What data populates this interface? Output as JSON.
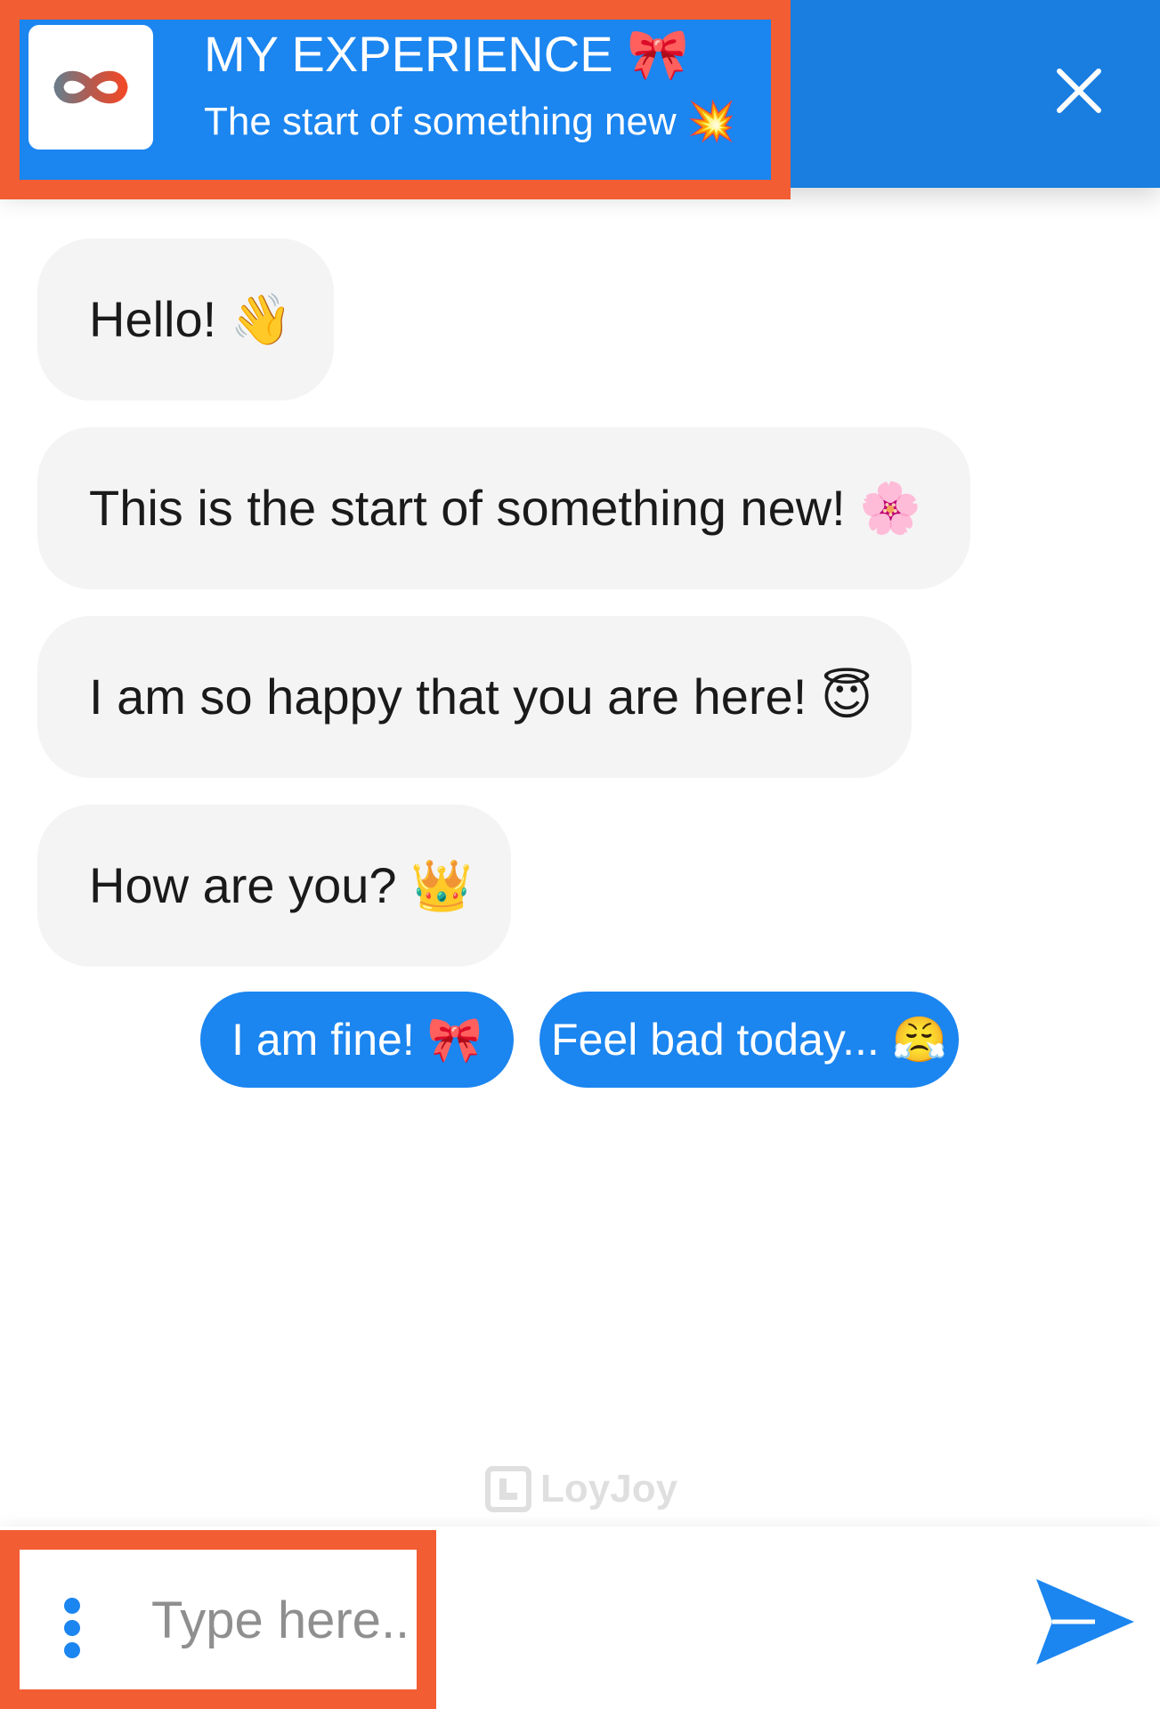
{
  "header": {
    "title": "MY EXPERIENCE 🎀",
    "subtitle": "The start of something new 💥",
    "logo_icon": "infinity-logo-icon",
    "close_icon": "close-icon",
    "background_color": "#1b85f0",
    "highlight_color": "#f25d34"
  },
  "messages": [
    {
      "text": "Hello! 👋"
    },
    {
      "text": "This is the start of something new! 🌸"
    },
    {
      "text": "I am so happy that you are here! 😇"
    },
    {
      "text": "How are you? 👑"
    }
  ],
  "quick_replies": [
    {
      "label": "I am fine! 🎀"
    },
    {
      "label": "Feel bad today... 😤"
    }
  ],
  "watermark": {
    "text": "LoyJoy"
  },
  "composer": {
    "placeholder": "Type here...",
    "menu_icon": "vertical-dots-icon",
    "send_icon": "send-icon",
    "accent_color": "#1b85f0"
  }
}
